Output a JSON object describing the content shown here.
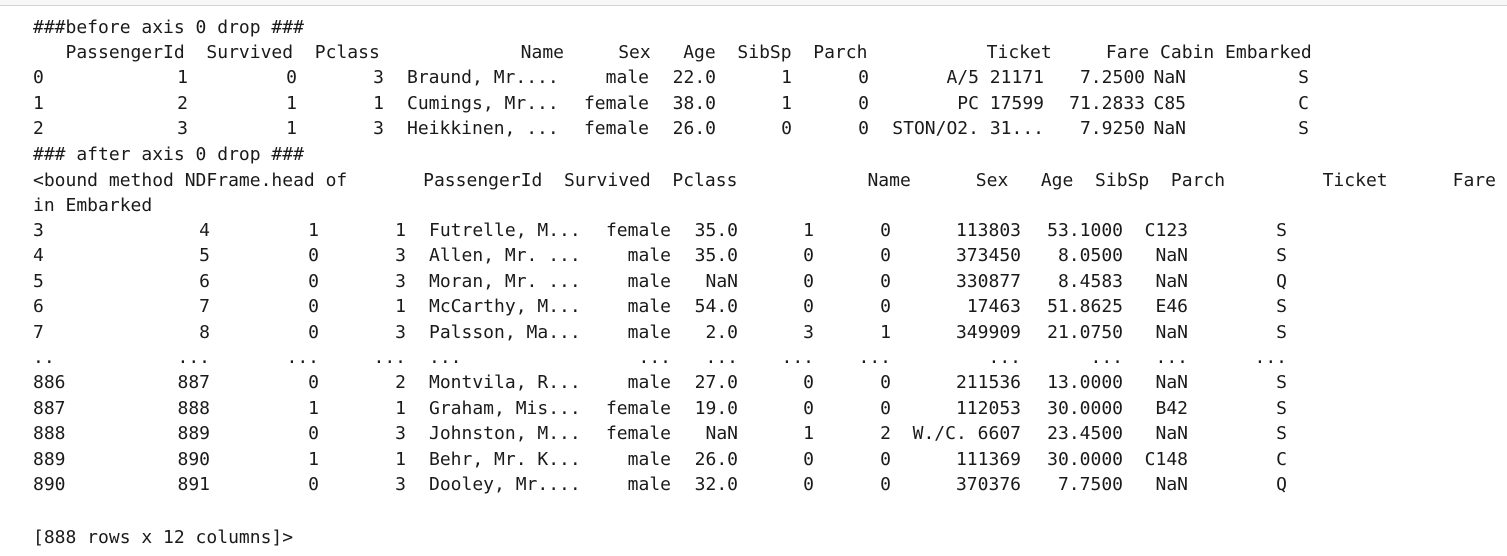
{
  "before_title": "###before axis 0 drop ###",
  "before_header": "   PassengerId  Survived  Pclass             Name     Sex   Age  SibSp  Parch           Ticket     Fare Cabin Embarked",
  "before_rows": [
    [
      "0",
      "1",
      "0",
      "3",
      "Braund, Mr....",
      "male",
      "22.0",
      "1",
      "0",
      "A/5 21171",
      "7.2500",
      "NaN",
      "S"
    ],
    [
      "1",
      "2",
      "1",
      "1",
      "Cumings, Mr...",
      "female",
      "38.0",
      "1",
      "0",
      "PC 17599",
      "71.2833",
      "C85",
      "C"
    ],
    [
      "2",
      "3",
      "1",
      "3",
      "Heikkinen, ...",
      "female",
      "26.0",
      "0",
      "0",
      "STON/O2. 31...",
      "7.9250",
      "NaN",
      "S"
    ]
  ],
  "after_title": "### after axis 0 drop ###",
  "after_header_line1": "<bound method NDFrame.head of       PassengerId  Survived  Pclass            Name      Sex   Age  SibSp  Parch         Ticket      Fare Cab",
  "after_header_line2": "in Embarked",
  "after_rows": [
    [
      "3",
      "4",
      "1",
      "1",
      "Futrelle, M...",
      "female",
      "35.0",
      "1",
      "0",
      "113803",
      "53.1000",
      "C123",
      "S"
    ],
    [
      "4",
      "5",
      "0",
      "3",
      "Allen, Mr. ...",
      "male",
      "35.0",
      "0",
      "0",
      "373450",
      "8.0500",
      "NaN",
      "S"
    ],
    [
      "5",
      "6",
      "0",
      "3",
      "Moran, Mr. ...",
      "male",
      "NaN",
      "0",
      "0",
      "330877",
      "8.4583",
      "NaN",
      "Q"
    ],
    [
      "6",
      "7",
      "0",
      "1",
      "McCarthy, M...",
      "male",
      "54.0",
      "0",
      "0",
      "17463",
      "51.8625",
      "E46",
      "S"
    ],
    [
      "7",
      "8",
      "0",
      "3",
      "Palsson, Ma...",
      "male",
      "2.0",
      "3",
      "1",
      "349909",
      "21.0750",
      "NaN",
      "S"
    ],
    [
      "..",
      "...",
      "...",
      "...",
      "...",
      "...",
      "...",
      "...",
      "...",
      "...",
      "...",
      "...",
      "..."
    ],
    [
      "886",
      "887",
      "0",
      "2",
      "Montvila, R...",
      "male",
      "27.0",
      "0",
      "0",
      "211536",
      "13.0000",
      "NaN",
      "S"
    ],
    [
      "887",
      "888",
      "1",
      "1",
      "Graham, Mis...",
      "female",
      "19.0",
      "0",
      "0",
      "112053",
      "30.0000",
      "B42",
      "S"
    ],
    [
      "888",
      "889",
      "0",
      "3",
      "Johnston, M...",
      "female",
      "NaN",
      "1",
      "2",
      "W./C. 6607",
      "23.4500",
      "NaN",
      "S"
    ],
    [
      "889",
      "890",
      "1",
      "1",
      "Behr, Mr. K...",
      "male",
      "26.0",
      "0",
      "0",
      "111369",
      "30.0000",
      "C148",
      "C"
    ],
    [
      "890",
      "891",
      "0",
      "3",
      "Dooley, Mr....",
      "male",
      "32.0",
      "0",
      "0",
      "370376",
      "7.7500",
      "NaN",
      "Q"
    ]
  ],
  "footer": "[888 rows x 12 columns]>"
}
